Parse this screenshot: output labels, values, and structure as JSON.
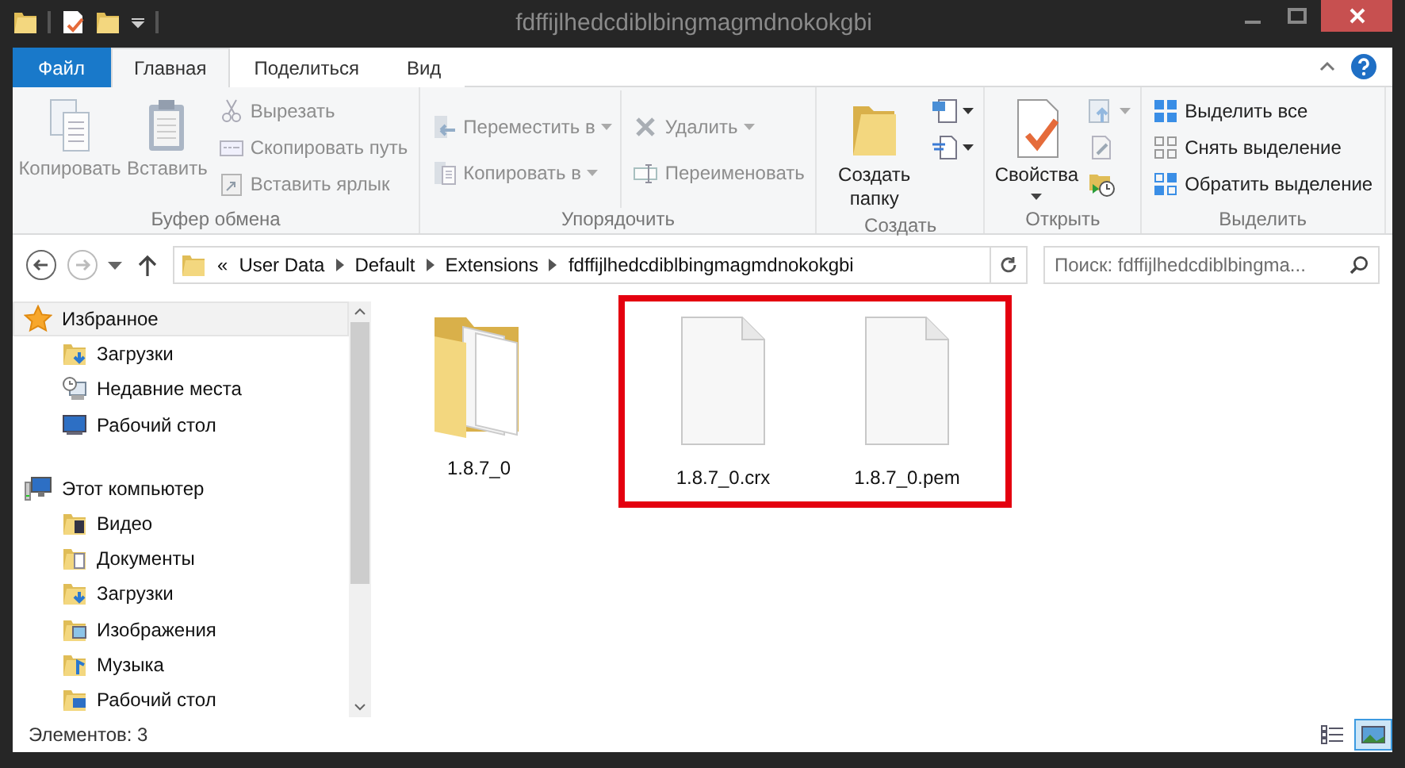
{
  "window": {
    "title": "fdffijlhedcdiblbingmagmdnokokgbi"
  },
  "ribbon_tabs": [
    {
      "label": "Файл",
      "kind": "file",
      "selected": false
    },
    {
      "label": "Главная",
      "kind": "tab",
      "selected": true
    },
    {
      "label": "Поделиться",
      "kind": "tab",
      "selected": false
    },
    {
      "label": "Вид",
      "kind": "tab",
      "selected": false
    }
  ],
  "ribbon_groups": [
    {
      "label": "Буфер обмена",
      "columns": [
        [
          {
            "kind": "large",
            "label": "Копировать",
            "disabled": true,
            "dropdown": false
          }
        ],
        [
          {
            "kind": "large",
            "label": "Вставить",
            "disabled": true,
            "dropdown": false
          }
        ],
        [
          {
            "kind": "small",
            "label": "Вырезать",
            "disabled": true,
            "dropdown": false
          },
          {
            "kind": "small",
            "label": "Скопировать путь",
            "disabled": true,
            "dropdown": false
          },
          {
            "kind": "small",
            "label": "Вставить ярлык",
            "disabled": true,
            "dropdown": false
          }
        ]
      ]
    },
    {
      "label": "Упорядочить",
      "columns": [
        [
          {
            "kind": "small",
            "label": "Переместить в",
            "disabled": true,
            "dropdown": true
          },
          {
            "kind": "small",
            "label": "Копировать в",
            "disabled": true,
            "dropdown": true
          }
        ],
        [
          {
            "kind": "small",
            "label": "Удалить",
            "disabled": true,
            "dropdown": true
          },
          {
            "kind": "small",
            "label": "Переименовать",
            "disabled": true,
            "dropdown": false
          }
        ]
      ]
    },
    {
      "label": "Создать",
      "columns": [
        [
          {
            "kind": "large",
            "label": "Создать папку",
            "disabled": false,
            "dropdown": false
          }
        ],
        [
          {
            "kind": "icon",
            "disabled": false,
            "dropdown": true
          },
          {
            "kind": "icon",
            "disabled": false,
            "dropdown": true
          }
        ]
      ]
    },
    {
      "label": "Открыть",
      "columns": [
        [
          {
            "kind": "large",
            "label": "Свойства",
            "disabled": false,
            "dropdown": true
          }
        ],
        [
          {
            "kind": "icon",
            "disabled": true,
            "dropdown": true
          },
          {
            "kind": "icon",
            "disabled": true,
            "dropdown": false
          },
          {
            "kind": "icon",
            "disabled": false,
            "dropdown": false
          }
        ]
      ]
    },
    {
      "label": "Выделить",
      "columns": [
        [
          {
            "kind": "small",
            "label": "Выделить все",
            "disabled": false,
            "dropdown": false
          },
          {
            "kind": "small",
            "label": "Снять выделение",
            "disabled": false,
            "dropdown": false
          },
          {
            "kind": "small",
            "label": "Обратить выделение",
            "disabled": false,
            "dropdown": false
          }
        ]
      ]
    }
  ],
  "address_bar": {
    "overflow": "«",
    "crumbs": [
      "User Data",
      "Default",
      "Extensions",
      "fdffijlhedcdiblbingmagmdnokokgbi"
    ]
  },
  "search": {
    "placeholder": "Поиск: fdffijlhedcdiblbingma..."
  },
  "nav_pane": [
    {
      "label": "Избранное",
      "selected": true,
      "children": [
        {
          "label": "Загрузки",
          "selected": false
        },
        {
          "label": "Недавние места",
          "selected": false
        },
        {
          "label": "Рабочий стол",
          "selected": false
        }
      ]
    },
    {
      "label": "Этот компьютер",
      "selected": false,
      "children": [
        {
          "label": "Видео",
          "selected": false
        },
        {
          "label": "Документы",
          "selected": false
        },
        {
          "label": "Загрузки",
          "selected": false
        },
        {
          "label": "Изображения",
          "selected": false
        },
        {
          "label": "Музыка",
          "selected": false
        },
        {
          "label": "Рабочий стол",
          "selected": false
        }
      ]
    }
  ],
  "files": [
    {
      "name": "1.8.7_0",
      "kind": "folder",
      "highlighted": false
    },
    {
      "name": "1.8.7_0.crx",
      "kind": "file",
      "highlighted": true
    },
    {
      "name": "1.8.7_0.pem",
      "kind": "file",
      "highlighted": true
    }
  ],
  "status_bar": {
    "text": "Элементов: 3",
    "views": [
      {
        "selected": false
      },
      {
        "selected": true
      }
    ]
  }
}
